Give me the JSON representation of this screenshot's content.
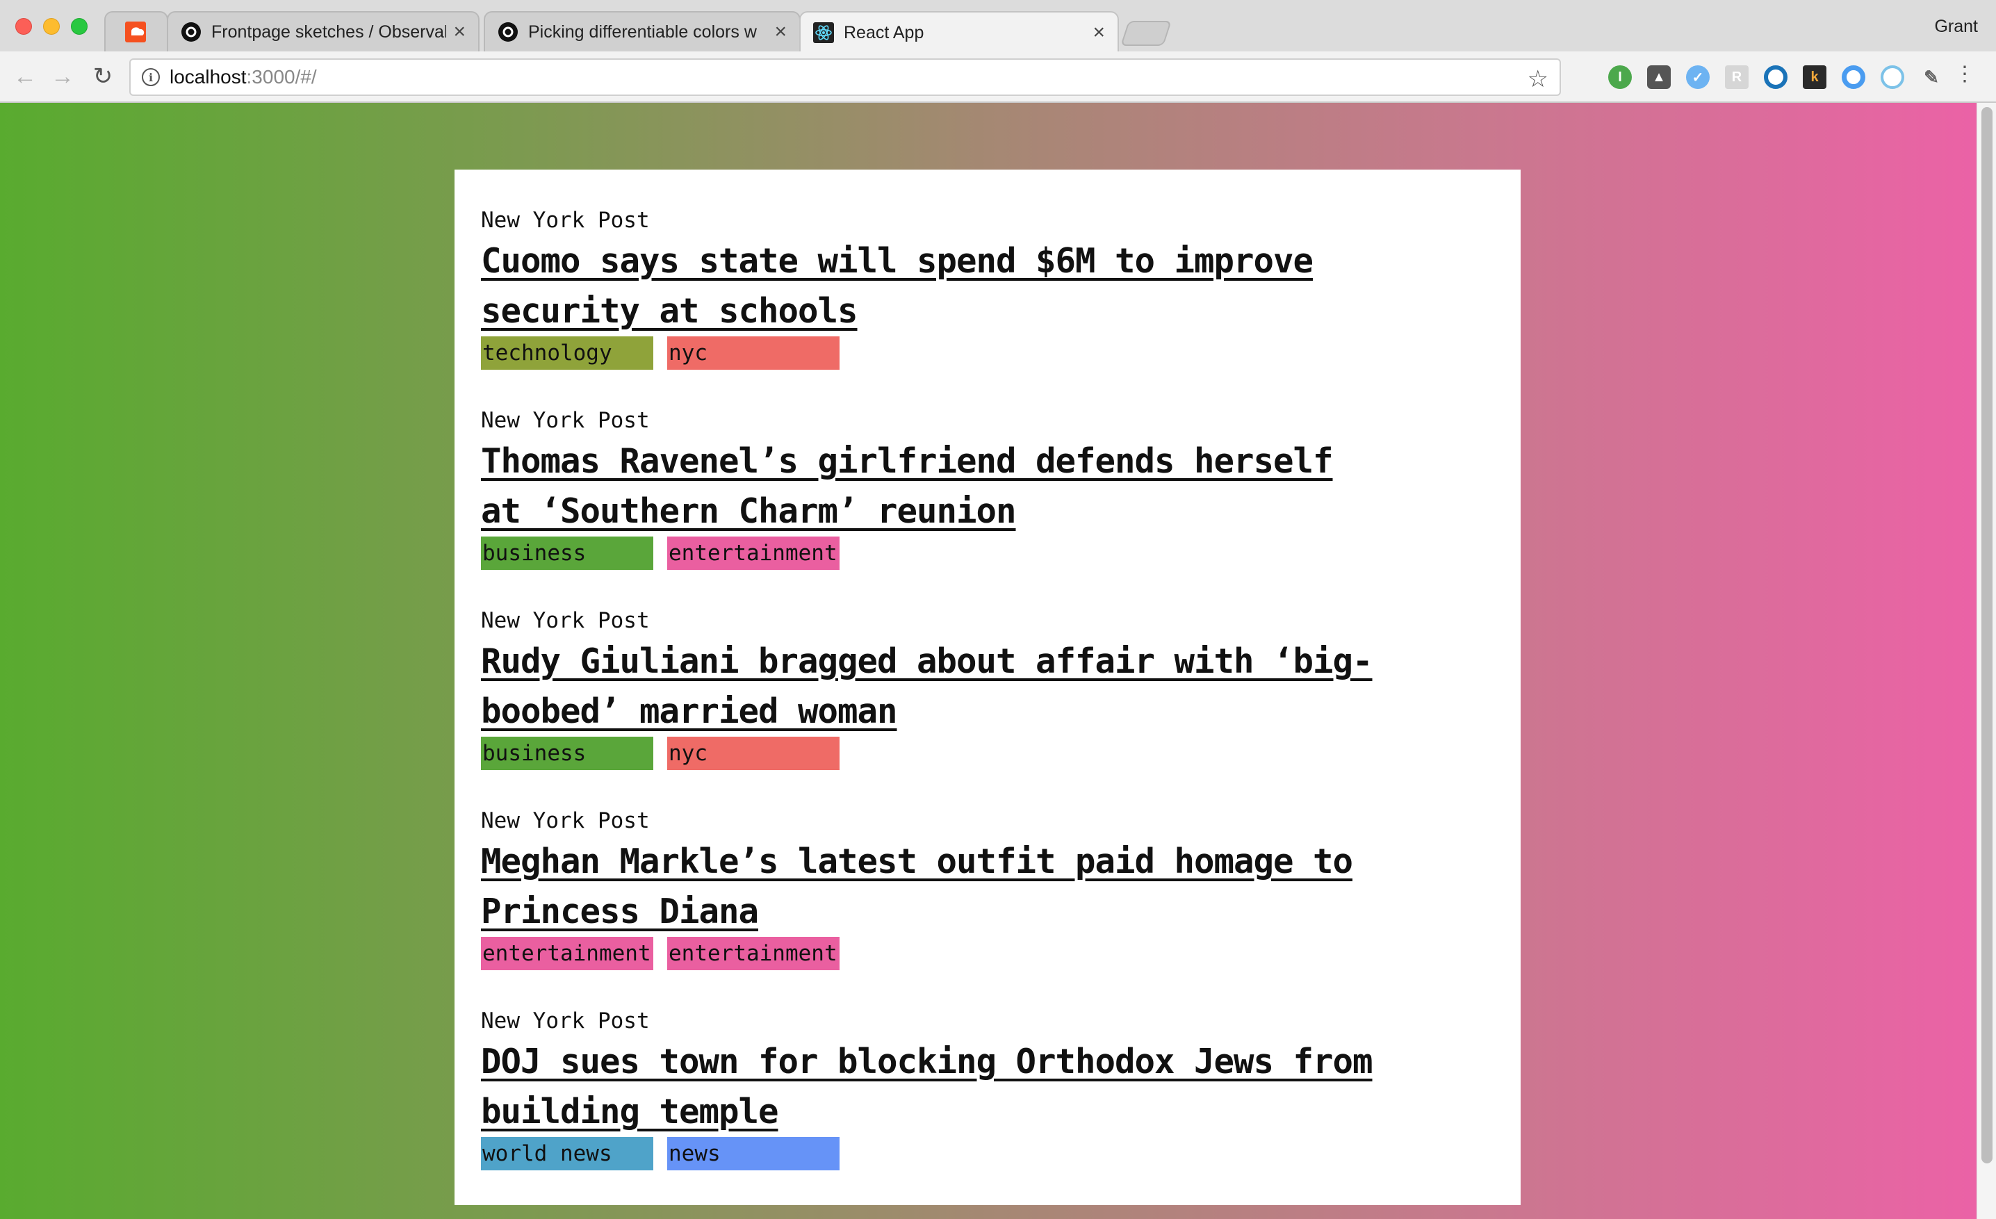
{
  "browser": {
    "tabs": [
      {
        "title": "",
        "favicon": "soundcloud-icon",
        "active": false
      },
      {
        "title": "Frontpage sketches / Observal",
        "favicon": "observable-icon",
        "active": false
      },
      {
        "title": "Picking differentiable colors w",
        "favicon": "observable-icon",
        "active": false
      },
      {
        "title": "React App",
        "favicon": "react-icon",
        "active": true
      }
    ],
    "profile_name": "Grant",
    "url_host": "localhost",
    "url_rest": ":3000/#/",
    "extensions": [
      "ghostery-icon",
      "wallabag-icon",
      "pocket-like-icon",
      "r-icon",
      "o-icon",
      "k-icon",
      "circle-icon",
      "target-icon",
      "pin-icon"
    ]
  },
  "stories": [
    {
      "source": "New York Post",
      "headline": "Cuomo says state will spend $6M to improve security at schools",
      "tags": [
        {
          "label": "technology",
          "color": "#8fa33a"
        },
        {
          "label": "nyc",
          "color": "#ef6b66"
        }
      ]
    },
    {
      "source": "New York Post",
      "headline": "Thomas Ravenel’s girlfriend defends herself at ‘Southern Charm’ reunion",
      "tags": [
        {
          "label": "business",
          "color": "#5aa63a"
        },
        {
          "label": "entertainment",
          "color": "#ea5fa0"
        }
      ]
    },
    {
      "source": "New York Post",
      "headline": "Rudy Giuliani bragged about affair with ‘big-boobed’ married woman",
      "tags": [
        {
          "label": "business",
          "color": "#5aa63a"
        },
        {
          "label": "nyc",
          "color": "#ef6b66"
        }
      ]
    },
    {
      "source": "New York Post",
      "headline": "Meghan Markle’s latest outfit paid homage to Princess Diana",
      "tags": [
        {
          "label": "entertainment",
          "color": "#ea5fa0"
        },
        {
          "label": "entertainment",
          "color": "#ea5fa0"
        }
      ]
    },
    {
      "source": "New York Post",
      "headline": "DOJ sues town for blocking Orthodox Jews from building temple",
      "tags": [
        {
          "label": "world news",
          "color": "#4fa3c9"
        },
        {
          "label": "news",
          "color": "#6693f7"
        }
      ]
    }
  ]
}
